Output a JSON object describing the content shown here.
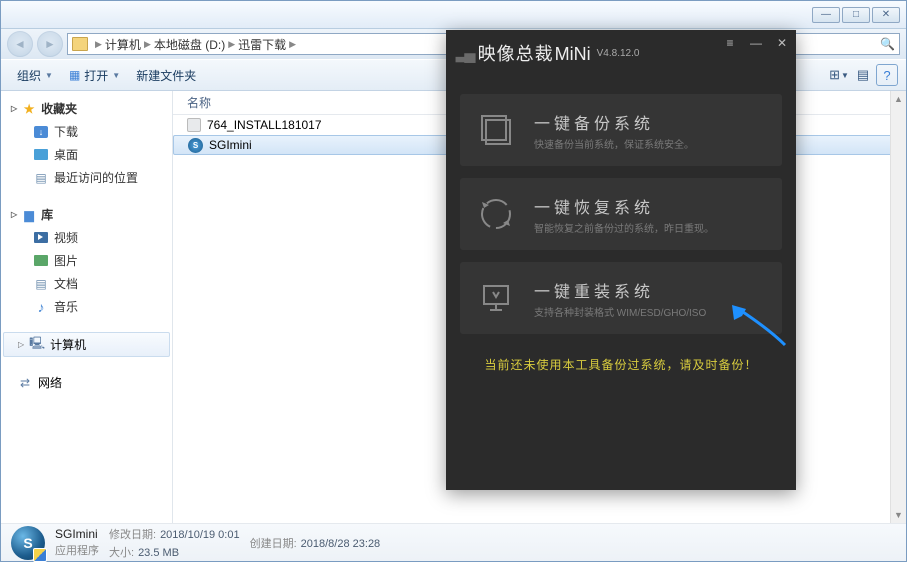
{
  "window": {
    "minimize": "—",
    "maximize": "□",
    "close": "✕"
  },
  "breadcrumb": {
    "root": "计算机",
    "drive": "本地磁盘 (D:)",
    "folder": "迅雷下载"
  },
  "toolbar": {
    "organize": "组织",
    "open": "打开",
    "newfolder": "新建文件夹"
  },
  "nav": {
    "favorites": "收藏夹",
    "downloads": "下载",
    "desktop": "桌面",
    "recent": "最近访问的位置",
    "libraries": "库",
    "videos": "视频",
    "pictures": "图片",
    "documents": "文档",
    "music": "音乐",
    "computer": "计算机",
    "network": "网络"
  },
  "columns": {
    "name": "名称"
  },
  "files": [
    {
      "name": "764_INSTALL181017",
      "type": "iso",
      "selected": false
    },
    {
      "name": "SGImini",
      "type": "exe",
      "selected": true
    }
  ],
  "details": {
    "name": "SGImini",
    "type": "应用程序",
    "mod_label": "修改日期:",
    "mod_value": "2018/10/19 0:01",
    "size_label": "大小:",
    "size_value": "23.5 MB",
    "created_label": "创建日期:",
    "created_value": "2018/8/28 23:28"
  },
  "sgi": {
    "brand": "映像总裁",
    "brand_suffix": "MiNi",
    "version": "V4.8.12.0",
    "opt_backup_title": "一键备份系统",
    "opt_backup_desc": "快速备份当前系统，保证系统安全。",
    "opt_restore_title": "一键恢复系统",
    "opt_restore_desc": "智能恢复之前备份过的系统，昨日重现。",
    "opt_reinstall_title": "一键重装系统",
    "opt_reinstall_desc": "支持各种封装格式 WIM/ESD/GHO/ISO",
    "warning": "当前还未使用本工具备份过系统，请及时备份！"
  }
}
